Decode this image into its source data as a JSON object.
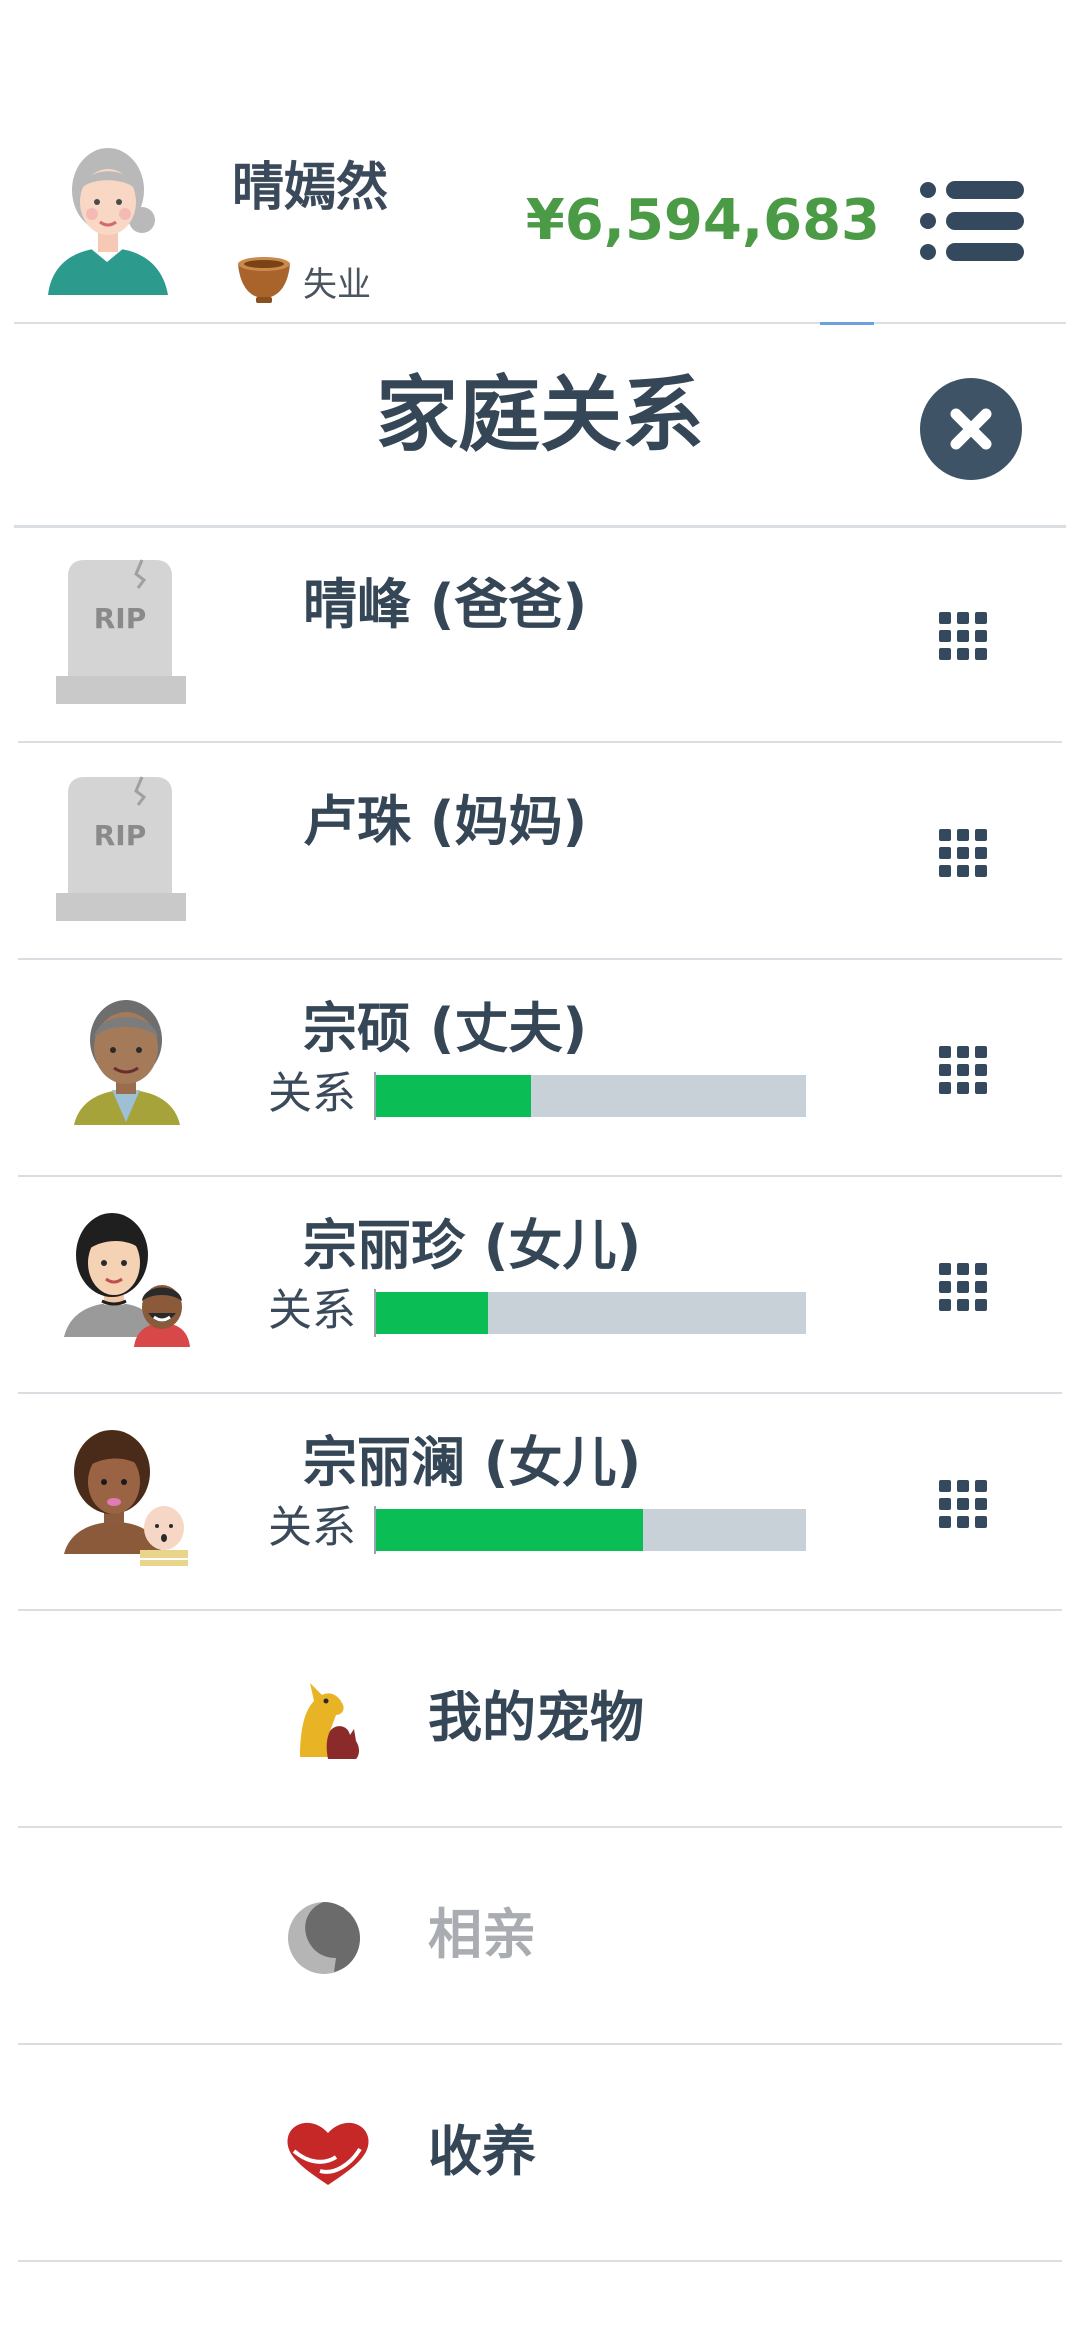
{
  "header": {
    "player_name": "晴嫣然",
    "job": "失业",
    "money": "¥6,594,683",
    "colors": {
      "money": "#4a9a46",
      "divider_accent": "#6aa3de"
    }
  },
  "panel": {
    "title": "家庭关系"
  },
  "relatives": [
    {
      "name": "晴峰 (爸爸)",
      "status": "deceased",
      "portrait": "tombstone-icon",
      "portrait_text": "RIP"
    },
    {
      "name": "卢珠 (妈妈)",
      "status": "deceased",
      "portrait": "tombstone-icon",
      "portrait_text": "RIP"
    },
    {
      "name": "宗硕 (丈夫)",
      "status": "alive",
      "portrait": "elderly-man-avatar",
      "relation_label": "关系",
      "relation_level": 0.36
    },
    {
      "name": "宗丽珍 (女儿)",
      "status": "alive",
      "portrait": "woman-with-child-avatar",
      "relation_label": "关系",
      "relation_level": 0.26
    },
    {
      "name": "宗丽澜 (女儿)",
      "status": "alive",
      "portrait": "woman-with-baby-avatar",
      "relation_label": "关系",
      "relation_level": 0.62
    }
  ],
  "actions": [
    {
      "label": "我的宠物",
      "icon": "pets-icon",
      "enabled": true
    },
    {
      "label": "相亲",
      "icon": "dating-icon",
      "enabled": false
    },
    {
      "label": "收养",
      "icon": "adoption-heart-icon",
      "enabled": true
    }
  ],
  "colors": {
    "relation_fill": "#0bbd55",
    "relation_track": "#c8d0d8",
    "text_primary": "#354656",
    "close_button": "#3e5366"
  }
}
